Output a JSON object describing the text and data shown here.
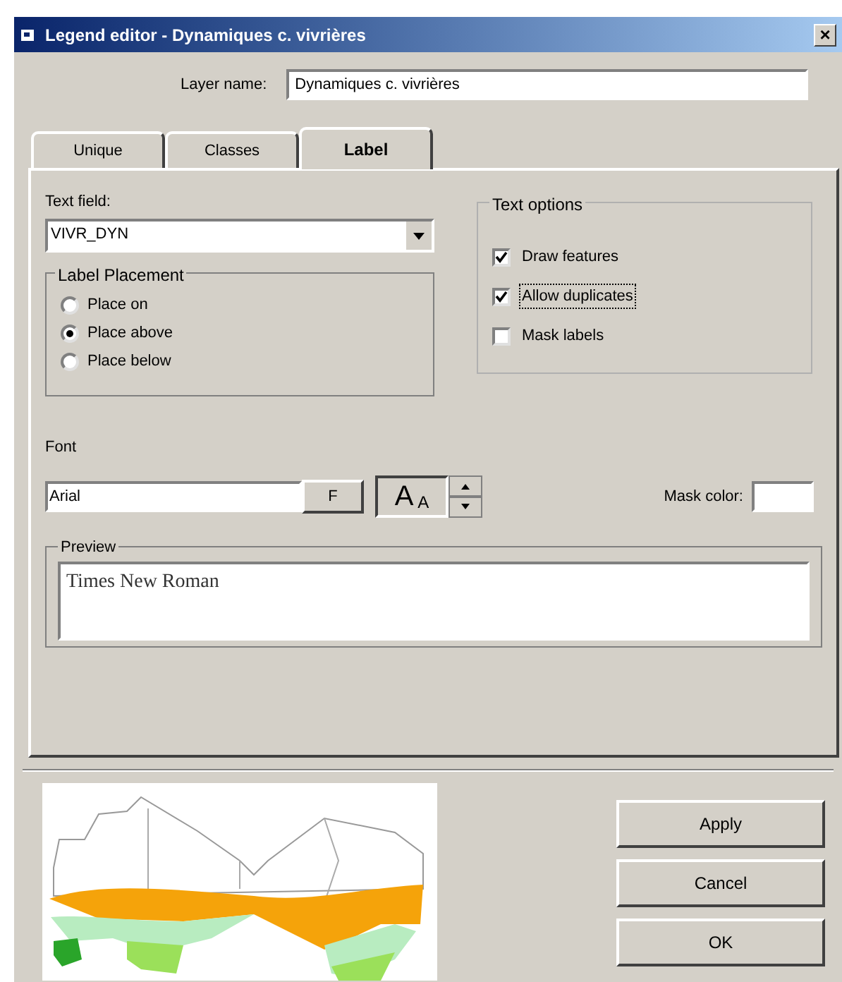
{
  "window": {
    "title": "Legend editor - Dynamiques c. vivrières",
    "close": "×"
  },
  "layer_name": {
    "label": "Layer name:",
    "value": "Dynamiques c. vivrières"
  },
  "tabs": [
    {
      "label": "Unique",
      "selected": false
    },
    {
      "label": "Classes",
      "selected": false
    },
    {
      "label": "Label",
      "selected": true
    }
  ],
  "text_field": {
    "label": "Text field:",
    "value": "VIVR_DYN"
  },
  "label_placement": {
    "title": "Label Placement",
    "options": [
      {
        "label": "Place on",
        "selected": false
      },
      {
        "label": "Place above",
        "selected": true
      },
      {
        "label": "Place below",
        "selected": false
      }
    ]
  },
  "text_options": {
    "title": "Text options",
    "options": [
      {
        "label": "Draw features",
        "checked": true,
        "focused": false
      },
      {
        "label": "Allow duplicates",
        "checked": true,
        "focused": true
      },
      {
        "label": "Mask labels",
        "checked": false,
        "focused": false
      }
    ]
  },
  "font": {
    "label": "Font",
    "value": "Arial",
    "button": "F",
    "size_large": "A",
    "size_small": "A"
  },
  "mask_color": {
    "label": "Mask color:"
  },
  "preview": {
    "title": "Preview",
    "text": "Times New Roman"
  },
  "buttons": [
    "Apply",
    "Cancel",
    "OK"
  ]
}
